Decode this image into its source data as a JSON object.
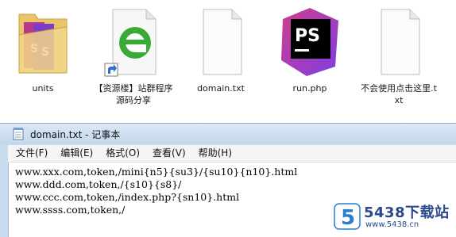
{
  "desktop": {
    "icons": [
      {
        "label": "units",
        "kind": "folder-icon"
      },
      {
        "label": "【资源楼】站群程序源码分享",
        "kind": "ie-shortcut-icon"
      },
      {
        "label": "domain.txt",
        "kind": "text-file-icon"
      },
      {
        "label": "run.php",
        "kind": "phpstorm-icon"
      },
      {
        "label": "不会使用点击这里.txt",
        "kind": "text-file-icon"
      }
    ]
  },
  "notepad": {
    "title": "domain.txt - 记事本",
    "menu": [
      "文件(F)",
      "编辑(E)",
      "格式(O)",
      "查看(V)",
      "帮助(H)"
    ],
    "lines": [
      "www.xxx.com,token,/mini{n5}{su3}/{su10}{n10}.html",
      "www.ddd.com,token,/{s10}{s8}/",
      "www.ccc.com,token,/index.php?{sn10}.html",
      "www.ssss.com,token,/"
    ]
  },
  "watermark": {
    "badge": "5",
    "brand": "5438下载站",
    "url": "www.5438.cn"
  },
  "colors": {
    "titlebar": "#c9dcef",
    "ie_green": "#3aa935",
    "phpstorm_pink": "#d23d8a",
    "phpstorm_purple": "#7b3fe4",
    "watermark_blue": "#2a4a8c"
  }
}
